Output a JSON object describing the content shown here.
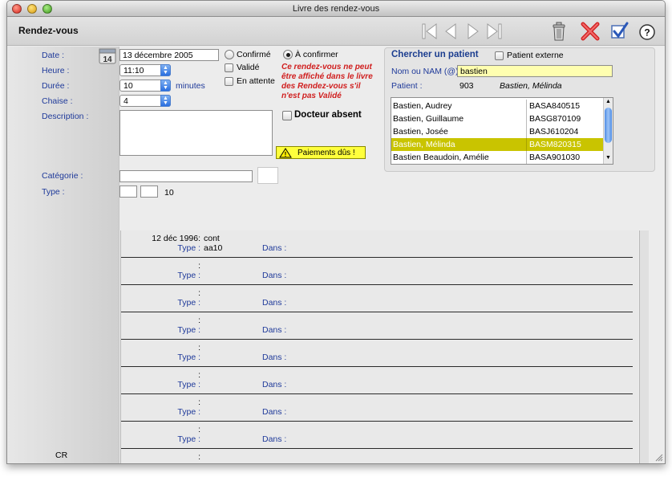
{
  "window": {
    "title": "Livre des rendez-vous"
  },
  "toolbar": {
    "section_title": "Rendez-vous"
  },
  "form": {
    "date_label": "Date :",
    "date_value": "13 décembre 2005",
    "calendar_day": "14",
    "heure_label": "Heure :",
    "heure_value": "11:10",
    "duree_label": "Durée :",
    "duree_value": "10",
    "minutes_label": "minutes",
    "chaise_label": "Chaise :",
    "chaise_value": "4",
    "description_label": "Description :",
    "description_value": "",
    "categorie_label": "Catégorie :",
    "categorie_value": "",
    "type_label": "Type :",
    "type_value1": "",
    "type_value2": "",
    "type_number": "10",
    "status": {
      "confirme": "Confirmé",
      "a_confirmer": "À confirmer",
      "valide": "Validé",
      "en_attente": "En attente",
      "selected": "a_confirmer"
    },
    "warning": "Ce rendez-vous ne peut être affiché dans le livre des Rendez-vous s'il n'est pas Validé",
    "docteur_absent": "Docteur absent",
    "paiements": "Paiements dûs !"
  },
  "search": {
    "title": "Chercher un patient",
    "externe_label": "Patient externe",
    "nom_label": "Nom ou NAM (@):",
    "nom_value": "bastien",
    "patient_label": "Patient :",
    "patient_id": "903",
    "patient_name": "Bastien, Mélinda",
    "results": [
      {
        "name": "Bastien, Audrey",
        "code": "BASA840515"
      },
      {
        "name": "Bastien, Guillaume",
        "code": "BASG870109"
      },
      {
        "name": "Bastien, Josée",
        "code": "BASJ610204"
      },
      {
        "name": "Bastien, Mélinda",
        "code": "BASM820315"
      },
      {
        "name": "Bastien Beaudoin, Amélie",
        "code": "BASA901030"
      }
    ],
    "selected_index": 3
  },
  "history": {
    "type_label": "Type :",
    "dans_label": "Dans :",
    "rows": [
      {
        "date": "12 déc 1996:",
        "detail": "cont",
        "type": "aa10"
      },
      {
        "date": ":",
        "detail": "",
        "type": ""
      },
      {
        "date": ":",
        "detail": "",
        "type": ""
      },
      {
        "date": ":",
        "detail": "",
        "type": ""
      },
      {
        "date": ":",
        "detail": "",
        "type": ""
      },
      {
        "date": ":",
        "detail": "",
        "type": ""
      },
      {
        "date": ":",
        "detail": "",
        "type": ""
      },
      {
        "date": ":",
        "detail": "",
        "type": ""
      },
      {
        "date": ":",
        "detail": "",
        "type": ""
      }
    ]
  },
  "footer": {
    "initials": "CR"
  },
  "colors": {
    "label_blue": "#1f3a9a",
    "warning_red": "#d01e1e",
    "selection": "#c9c400",
    "highlight_yellow": "#ffff3c"
  }
}
